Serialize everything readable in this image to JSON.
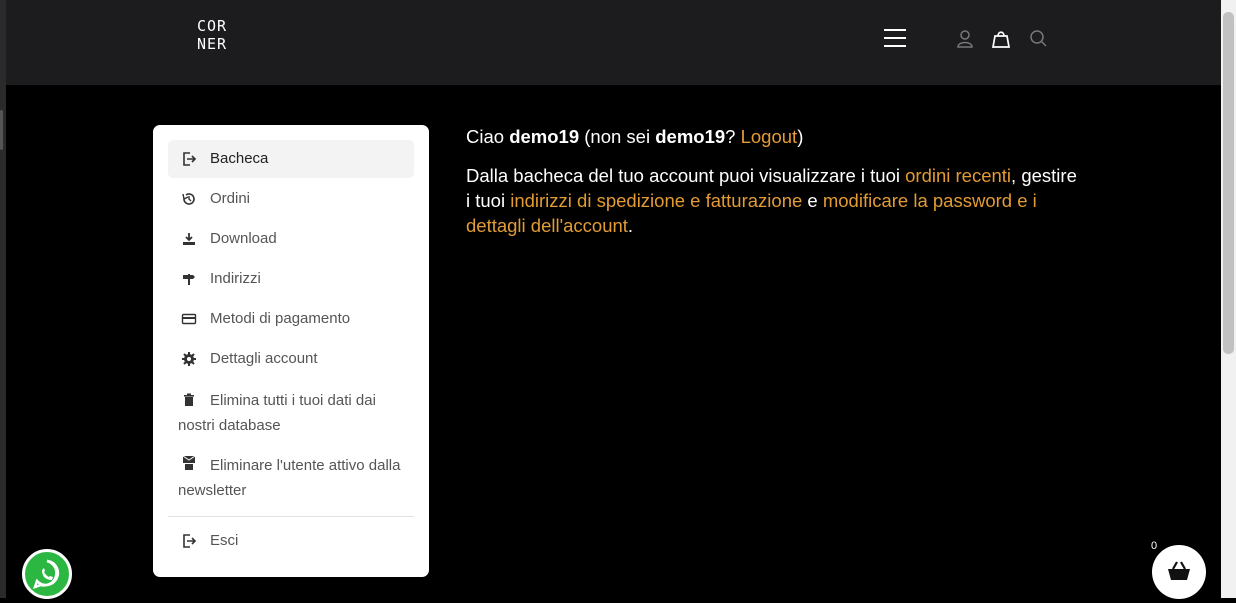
{
  "header": {
    "logo_line1": "COR",
    "logo_line2": "NER",
    "icons": [
      "menu-icon",
      "user-icon",
      "bag-icon",
      "search-icon"
    ]
  },
  "account_nav": {
    "items": [
      {
        "label": "Bacheca",
        "icon": "dashboard-icon",
        "active": true
      },
      {
        "label": "Ordini",
        "icon": "history-icon"
      },
      {
        "label": "Download",
        "icon": "download-icon"
      },
      {
        "label": "Indirizzi",
        "icon": "signpost-icon"
      },
      {
        "label": "Metodi di pagamento",
        "icon": "credit-card-icon"
      },
      {
        "label": "Dettagli account",
        "icon": "gear-icon"
      },
      {
        "label": "Elimina tutti i tuoi dati dai nostri database",
        "icon": "trash-icon"
      },
      {
        "label": "Eliminare l'utente attivo dalla newsletter",
        "icon": "mail-trash-icon"
      },
      {
        "label": "Esci",
        "icon": "logout-icon"
      }
    ]
  },
  "content": {
    "greet_prefix": "Ciao ",
    "username": "demo19",
    "greet_mid": " (non sei ",
    "username2": "demo19",
    "greet_q": "? ",
    "logout_link": "Logout",
    "greet_end": ")",
    "p1": "Dalla bacheca del tuo account puoi visualizzare i tuoi ",
    "link_orders": "ordini recenti",
    "p2": ", gestire i tuoi ",
    "link_addresses": "indirizzi di spedizione e fatturazione",
    "p3": " e ",
    "link_account": "modificare la password e i dettagli dell'account",
    "p4": "."
  },
  "floating": {
    "cart_count": "0",
    "whatsapp_icon": "whatsapp-icon",
    "cart_icon": "basket-icon"
  },
  "colors": {
    "accent": "#e39b34",
    "header_bg": "#1c1c1e",
    "page_bg": "#000000",
    "whatsapp": "#2cb742"
  }
}
